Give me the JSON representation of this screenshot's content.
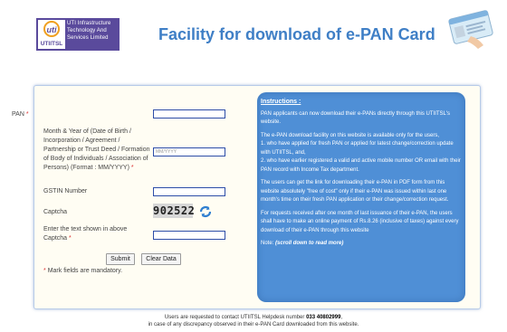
{
  "header": {
    "logo_short": "UTIITSL",
    "logo_brand": "uti",
    "logo_lines": [
      "UTI Infrastructure",
      "Technology And",
      "Services Limited"
    ],
    "title": "Facility for download of e-PAN Card"
  },
  "form": {
    "pan_label": "PAN",
    "dob_label": "Month & Year of (Date of Birth / Incorporation / Agreement / Partnership or Trust Deed / Formation of Body of Individuals / Association of Persons) (Format : MM/YYYY)",
    "dob_placeholder": "MM/YYYY",
    "gstin_label": "GSTIN Number",
    "captcha_label": "Captcha",
    "captcha_value": "902522",
    "captcha_text_label": "Enter the text shown in above Captcha",
    "submit_label": "Submit",
    "clear_label": "Clear Data",
    "mandatory_note": "Mark fields are mandatory.",
    "required_mark": "*"
  },
  "instructions": {
    "title": "Instructions :",
    "p1": "PAN applicants can now download their e-PANs directly through this UTIITSL's website.",
    "p2": "The e-PAN download facility on this website is available only for the users,",
    "p2a": "1. who have applied for fresh PAN or applied for latest change/correction update with UTIITSL, and,",
    "p2b": "2. who have earlier registered a valid and active mobile number OR email with their PAN record with Income Tax department.",
    "p3": "The users can get the link for downloading their e-PAN in PDF form from this website absolutely \"free of cost\" only if their e-PAN was issued within last one month's time on their fresh PAN application or their change/correction request.",
    "p4": "For requests received after one month of last issuance of their e-PAN, the users shall have to make an online payment of Rs.8.26 (inclusive of taxes) against every download of their e-PAN through this website",
    "note_label": "Note:",
    "note_text": "(scroll down to read more)"
  },
  "footer": {
    "line1_prefix": "Users are requested to contact UTIITSL Helpdesk number",
    "helpdesk_number": "033 40802999",
    "line1_suffix": ",",
    "line2": "in case of any discrepancy observed in their e-PAN Card downloaded from this website."
  },
  "colors": {
    "title": "#3f7fc6",
    "instructions_bg": "#4f8fd6",
    "input_border": "#2d4da8",
    "required": "#dd3333"
  }
}
